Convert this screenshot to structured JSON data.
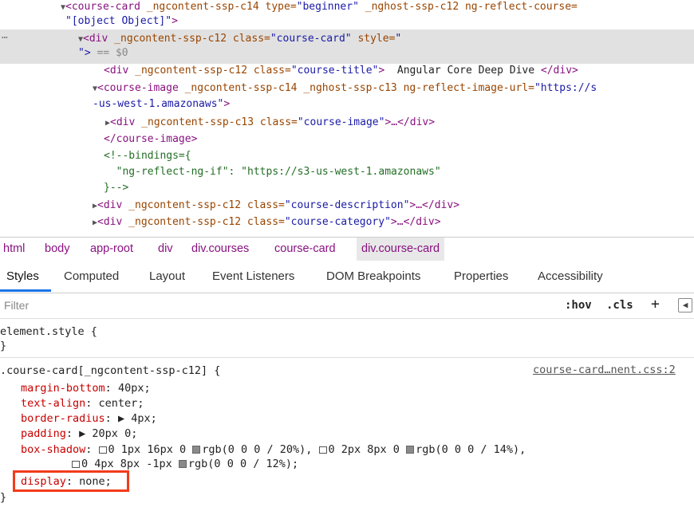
{
  "tree": {
    "line1": {
      "tag_open": "<course-card",
      "a1": "_ngcontent-ssp-c14",
      "a2": "type",
      "v2": "\"beginner\"",
      "a3": "_nghost-ssp-c12",
      "a4": "ng-reflect-course="
    },
    "line2": {
      "value": "\"[object Object]\"",
      "close": ">"
    },
    "line3": {
      "tag_open": "<div",
      "a1": "_ngcontent-ssp-c12",
      "a2": "class",
      "v2": "\"course-card\"",
      "a3": "style",
      "v3": "\""
    },
    "line4": {
      "close": "\">",
      "eq": " == $0"
    },
    "line5": {
      "tag_open": "<div",
      "a1": "_ngcontent-ssp-c12",
      "a2": "class",
      "v2": "\"course-title\"",
      "close": ">",
      "text": "  Angular Core Deep Dive ",
      "end": "</div>"
    },
    "line6": {
      "tag_open": "<course-image",
      "a1": "_ngcontent-ssp-c14",
      "a2": "_nghost-ssp-c13",
      "a3": "ng-reflect-image-url=",
      "v3": "\"https://s"
    },
    "line7": {
      "value": "-us-west-1.amazonaws\"",
      "close": ">"
    },
    "line8": {
      "tag_open": "<div",
      "a1": "_ngcontent-ssp-c13",
      "a2": "class",
      "v2": "\"course-image\"",
      "close": ">…</div>"
    },
    "line9": {
      "text": "</course-image>"
    },
    "line10": {
      "text": "<!--bindings={"
    },
    "line11": {
      "text": "  \"ng-reflect-ng-if\": \"https://s3-us-west-1.amazonaws\""
    },
    "line12": {
      "text": "}-->"
    },
    "line13": {
      "tag_open": "<div",
      "a1": "_ngcontent-ssp-c12",
      "a2": "class",
      "v2": "\"course-description\"",
      "close": ">…</div>"
    },
    "line14": {
      "tag_open": "<div",
      "a1": "_ngcontent-ssp-c12",
      "a2": "class",
      "v2": "\"course-category\"",
      "close": ">…</div>"
    }
  },
  "breadcrumb": [
    "html",
    "body",
    "app-root",
    "div",
    "div.courses",
    "course-card",
    "div.course-card"
  ],
  "tabs": [
    "Styles",
    "Computed",
    "Layout",
    "Event Listeners",
    "DOM Breakpoints",
    "Properties",
    "Accessibility"
  ],
  "filter": {
    "placeholder": "Filter",
    "hov": ":hov",
    "cls": ".cls",
    "plus": "+",
    "toggle": "◀"
  },
  "styles": {
    "element_style": "element.style {",
    "element_close": "}",
    "rule_selector": ".course-card[_ngcontent-ssp-c12] {",
    "rule_source": "course-card…nent.css:2",
    "decls": [
      {
        "prop": "margin-bottom",
        "val": "40px;"
      },
      {
        "prop": "text-align",
        "val": "center;"
      },
      {
        "prop": "border-radius",
        "val": "▶ 4px;"
      },
      {
        "prop": "padding",
        "val": "▶ 20px 0;"
      }
    ],
    "box_shadow": {
      "prop": "box-shadow",
      "part1": "0 1px 16px 0 ",
      "c1": "rgb(0 0 0 / 20%),",
      "part2": "0 2px 8px 0 ",
      "c2": "rgb(0 0 0 / 14%),",
      "part3": "0 4px 8px -1px ",
      "c3": "rgb(0 0 0 / 12%);"
    },
    "display": {
      "prop": "display",
      "val": "none;"
    },
    "rule_close": "}"
  },
  "colors": {
    "highlight_border": "#f23b1b",
    "accent": "#1a73e8"
  }
}
